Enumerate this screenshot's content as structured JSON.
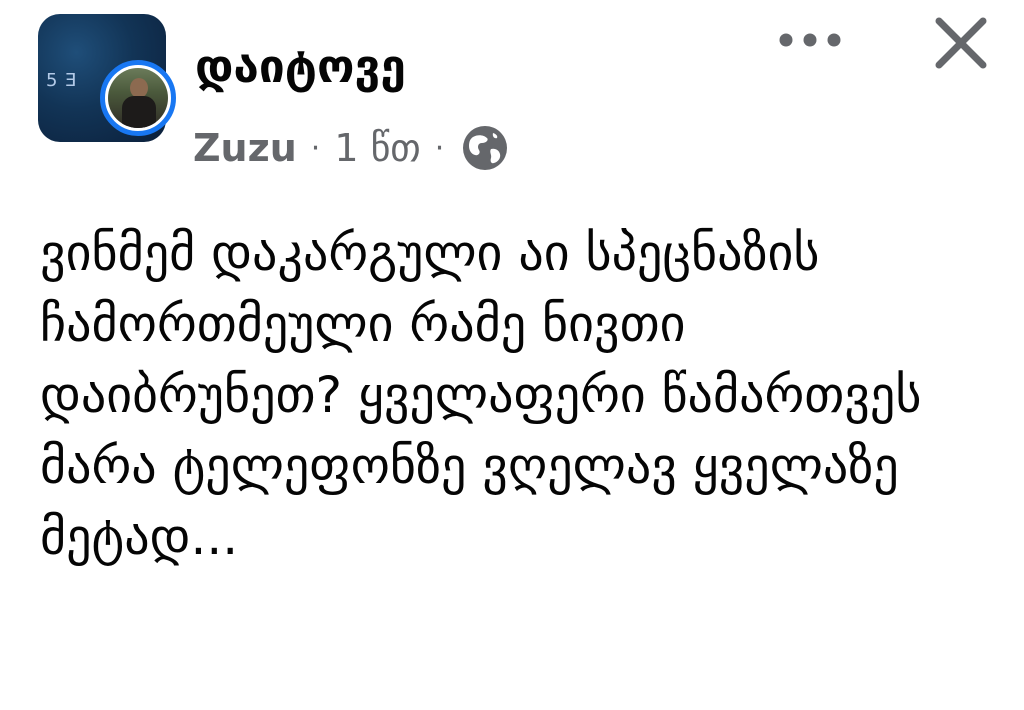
{
  "post": {
    "group_name": "დაიტოვე",
    "author": "Zuzu",
    "separator": "·",
    "time": "1 წთ",
    "privacy_icon": "globe-icon",
    "group_avatar_text": "5 Ǝ",
    "body": "ვინმემ დაკარგული აი სპეცნაზის ჩამორთმეული რამე ნივთი დაიბრუნეთ? ყველაფერი წამართვეს მარა ტელეფონზე ვღელავ ყველაზე მეტად..."
  },
  "actions": {
    "more_icon": "more-horizontal-icon",
    "close_icon": "close-icon"
  },
  "colors": {
    "text": "#050505",
    "secondary_text": "#65676b",
    "accent_ring": "#1877f2",
    "icon_gray": "#65676b"
  }
}
